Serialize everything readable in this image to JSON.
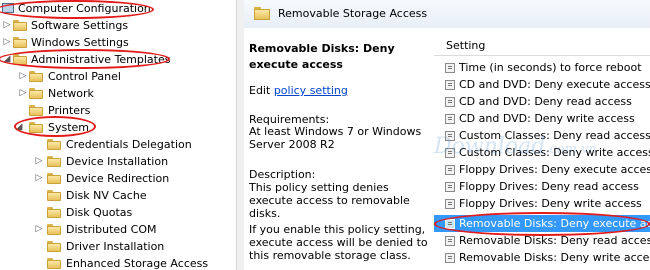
{
  "tree": {
    "items": [
      {
        "label": "Computer Configuration",
        "icon": "computer-icon",
        "arrow": ""
      },
      {
        "label": "Software Settings",
        "icon": "folder-icon",
        "arrow": "▷"
      },
      {
        "label": "Windows Settings",
        "icon": "folder-icon",
        "arrow": "▷"
      },
      {
        "label": "Administrative Templates",
        "icon": "folder-icon",
        "arrow": "◢"
      },
      {
        "label": "Control Panel",
        "icon": "folder-icon",
        "arrow": "▷"
      },
      {
        "label": "Network",
        "icon": "folder-icon",
        "arrow": "▷"
      },
      {
        "label": "Printers",
        "icon": "folder-icon",
        "arrow": ""
      },
      {
        "label": "System",
        "icon": "folder-icon",
        "arrow": "◢"
      },
      {
        "label": "Credentials Delegation",
        "icon": "folder-icon",
        "arrow": ""
      },
      {
        "label": "Device Installation",
        "icon": "folder-icon",
        "arrow": "▷"
      },
      {
        "label": "Device Redirection",
        "icon": "folder-icon",
        "arrow": "▷"
      },
      {
        "label": "Disk NV Cache",
        "icon": "folder-icon",
        "arrow": ""
      },
      {
        "label": "Disk Quotas",
        "icon": "folder-icon",
        "arrow": ""
      },
      {
        "label": "Distributed COM",
        "icon": "folder-icon",
        "arrow": "▷"
      },
      {
        "label": "Driver Installation",
        "icon": "folder-icon",
        "arrow": ""
      },
      {
        "label": "Enhanced Storage Access",
        "icon": "folder-icon",
        "arrow": ""
      }
    ]
  },
  "header": {
    "title": "Removable Storage Access"
  },
  "description": {
    "title": "Removable Disks: Deny execute access",
    "edit_prefix": "Edit",
    "edit_link": "policy setting",
    "requirements_label": "Requirements:",
    "requirements": "At least Windows 7 or Windows Server 2008 R2",
    "description_label": "Description:",
    "text1": "This policy setting denies execute access to removable disks.",
    "text2": "If you enable this policy setting, execute access will be denied to this removable storage class."
  },
  "settings": {
    "column_header": "Setting",
    "rows": [
      {
        "label": "Time (in seconds) to force reboot",
        "selected": false
      },
      {
        "label": "CD and DVD: Deny execute access",
        "selected": false
      },
      {
        "label": "CD and DVD: Deny read access",
        "selected": false
      },
      {
        "label": "CD and DVD: Deny write access",
        "selected": false
      },
      {
        "label": "Custom Classes: Deny read access",
        "selected": false
      },
      {
        "label": "Custom Classes: Deny write access",
        "selected": false
      },
      {
        "label": "Floppy Drives: Deny execute access",
        "selected": false
      },
      {
        "label": "Floppy Drives: Deny read access",
        "selected": false
      },
      {
        "label": "Floppy Drives: Deny write access",
        "selected": false
      },
      {
        "label": "Removable Disks: Deny execute access",
        "selected": true
      },
      {
        "label": "Removable Disks: Deny read access",
        "selected": false
      },
      {
        "label": "Removable Disks: Deny write access",
        "selected": false
      }
    ]
  },
  "watermark": {
    "text": "Download",
    "suffix": ".com.vn"
  },
  "colors": {
    "selection": "#3399ff",
    "highlight_ellipse": "#e21a1a",
    "link": "#0044cc"
  }
}
